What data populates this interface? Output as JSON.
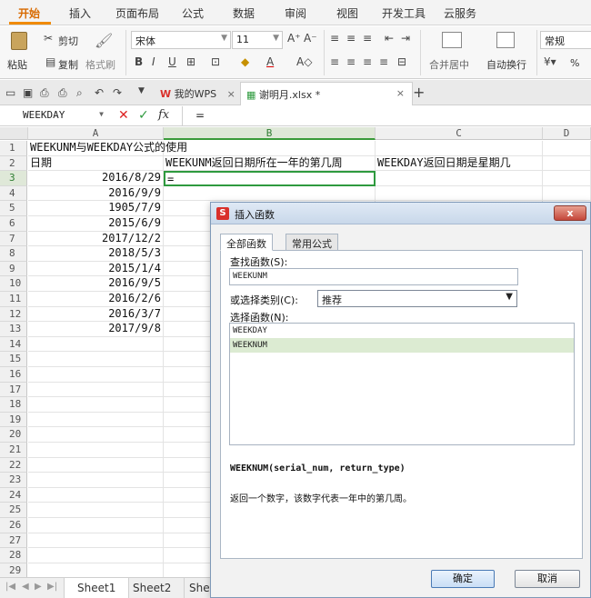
{
  "ribbon_tabs": [
    "开始",
    "插入",
    "页面布局",
    "公式",
    "数据",
    "审阅",
    "视图",
    "开发工具",
    "云服务"
  ],
  "ribbon": {
    "paste": "粘贴",
    "cut": "剪切",
    "copy": "复制",
    "format_painter": "格式刷",
    "font_name": "宋体",
    "font_size": "11",
    "merge_center": "合并居中",
    "wrap_text": "自动换行",
    "number_format": "常规",
    "percent": "%"
  },
  "doc_tabs": {
    "my_wps": "我的WPS",
    "file": "谢明月.xlsx *",
    "add": "+"
  },
  "formula_bar": {
    "name_box": "WEEKDAY",
    "fx": "fx",
    "formula": "="
  },
  "columns": [
    "A",
    "B",
    "C",
    "D"
  ],
  "rows": [
    "1",
    "2",
    "3",
    "4",
    "5",
    "6",
    "7",
    "8",
    "9",
    "10",
    "11",
    "12",
    "13",
    "14",
    "15",
    "16",
    "17",
    "18",
    "19",
    "20",
    "21",
    "22",
    "23",
    "24",
    "25",
    "26",
    "27",
    "28",
    "29"
  ],
  "cells": {
    "a1": "WEEKUNM与WEEKDAY公式的使用",
    "a2": "日期",
    "b2": "WEEKUNM返回日期所在一年的第几周",
    "c2": "WEEKDAY返回日期是星期几",
    "b3": "=",
    "dates": [
      "2016/8/29",
      "2016/9/9",
      "1905/7/9",
      "2015/6/9",
      "2017/12/2",
      "2018/5/3",
      "2015/1/4",
      "2016/9/5",
      "2016/2/6",
      "2016/3/7",
      "2017/9/8"
    ]
  },
  "sheet_tabs": [
    "Sheet1",
    "Sheet2",
    "Shee"
  ],
  "dialog": {
    "title": "插入函数",
    "close": "x",
    "tab_all": "全部函数",
    "tab_common": "常用公式",
    "search_label": "查找函数(S):",
    "search_value": "WEEKUNM",
    "category_label": "或选择类别(C):",
    "category_value": "推荐",
    "select_label": "选择函数(N):",
    "functions": [
      "WEEKDAY",
      "WEEKNUM"
    ],
    "signature": "WEEKNUM(serial_num, return_type)",
    "description": "返回一个数字，该数字代表一年中的第几周。",
    "ok": "确定",
    "cancel": "取消"
  },
  "colors": {
    "accent": "#f08a00",
    "selection_green": "#2e9a3e",
    "wps_red": "#d9302b"
  }
}
